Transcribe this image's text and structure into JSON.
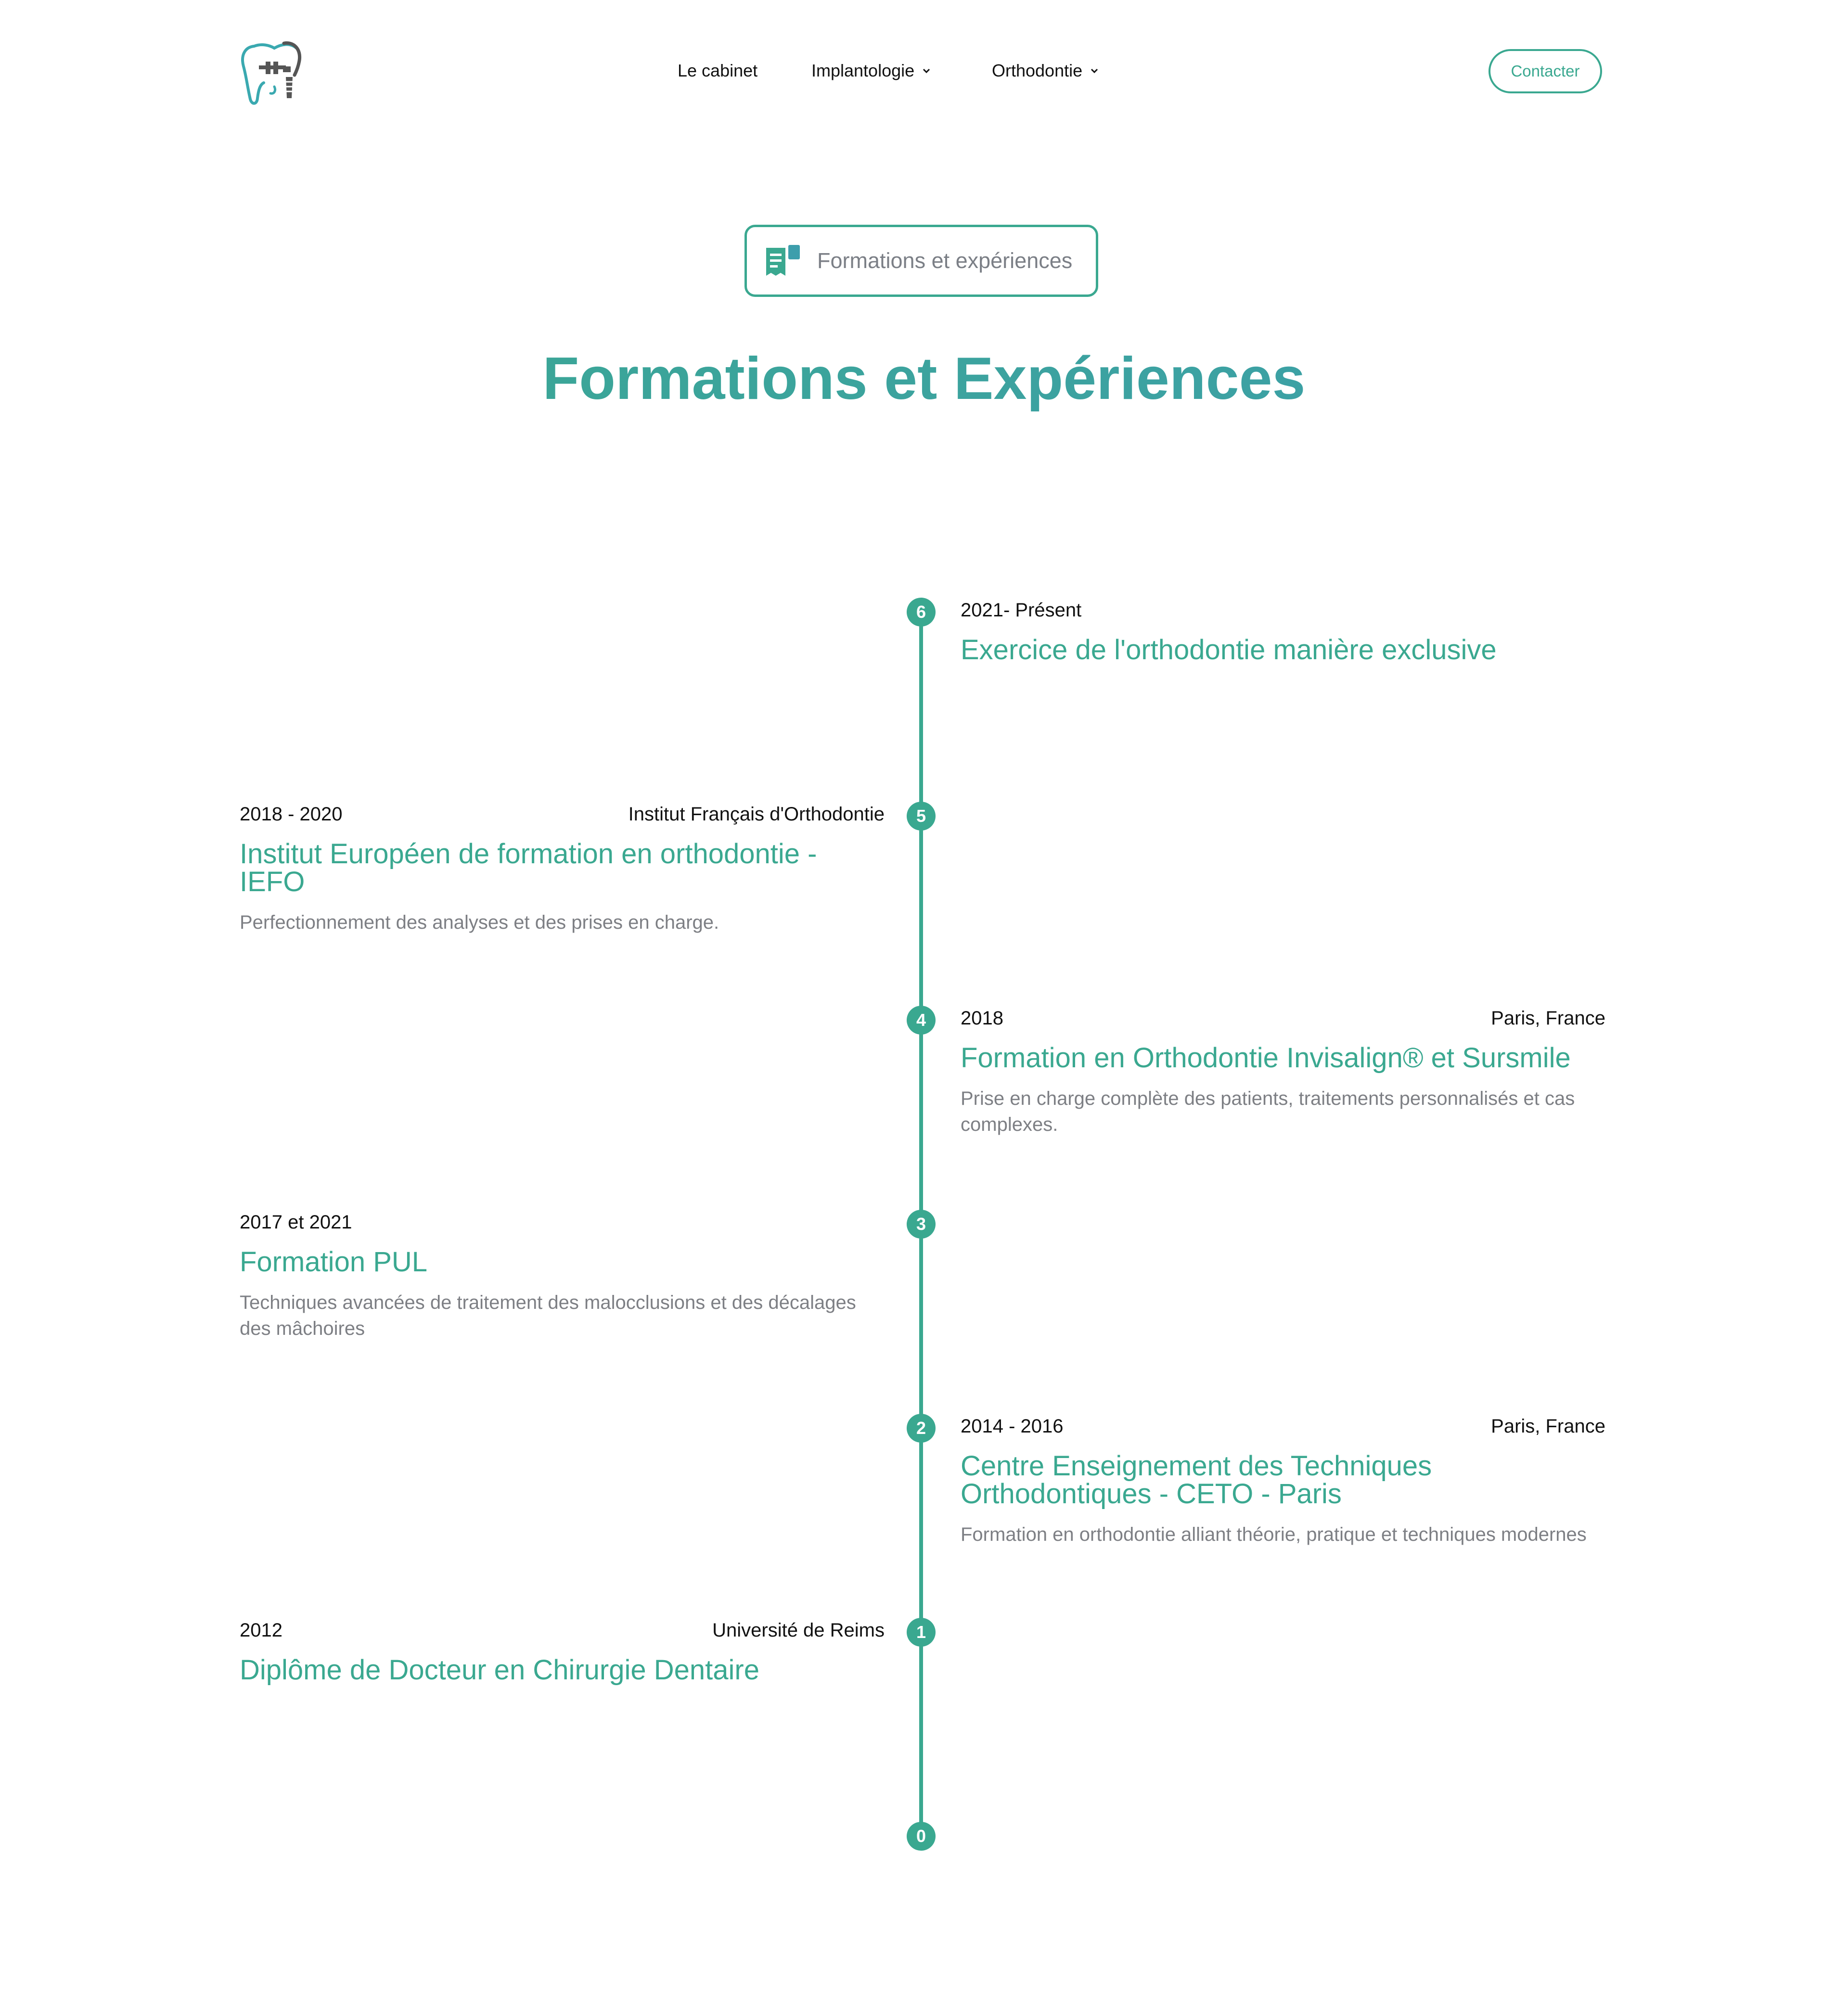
{
  "header": {
    "logo": "tooth-implant-logo",
    "nav": [
      {
        "label": "Le cabinet",
        "has_dropdown": false
      },
      {
        "label": "Implantologie",
        "has_dropdown": true
      },
      {
        "label": "Orthodontie",
        "has_dropdown": true
      }
    ],
    "contact_label": "Contacter"
  },
  "badge": {
    "icon": "document-icon",
    "label": "Formations et expériences"
  },
  "page_title": "Formations et Expériences",
  "timeline": {
    "accent": "#3aa890",
    "entries": [
      {
        "number": "6",
        "side": "right",
        "date": "2021- Présent",
        "place": "",
        "title": "Exercice de l'orthodontie manière exclusive",
        "description": ""
      },
      {
        "number": "5",
        "side": "left",
        "date": "2018 - 2020",
        "place": "Institut Français d'Orthodontie",
        "title": "Institut Européen de formation en orthodontie - IEFO",
        "description": "Perfectionnement des analyses et des prises en charge."
      },
      {
        "number": "4",
        "side": "right",
        "date": "2018",
        "place": "Paris, France",
        "title": "Formation en Orthodontie Invisalign® et Sursmile",
        "description": "Prise en charge complète des patients, traitements personnalisés et cas complexes."
      },
      {
        "number": "3",
        "side": "left",
        "date": "2017 et 2021",
        "place": "",
        "title": "Formation PUL",
        "description": "Techniques avancées de traitement des malocclusions et des décalages des mâchoires"
      },
      {
        "number": "2",
        "side": "right",
        "date": "2014 - 2016",
        "place": "Paris, France",
        "title": "Centre Enseignement des Techniques Orthodontiques - CETO - Paris",
        "description": "Formation en orthodontie alliant théorie, pratique et techniques modernes"
      },
      {
        "number": "1",
        "side": "left",
        "date": "2012",
        "place": "Université de Reims",
        "title": "Diplôme de Docteur en Chirurgie Dentaire",
        "description": ""
      }
    ],
    "end_marker": "0"
  }
}
